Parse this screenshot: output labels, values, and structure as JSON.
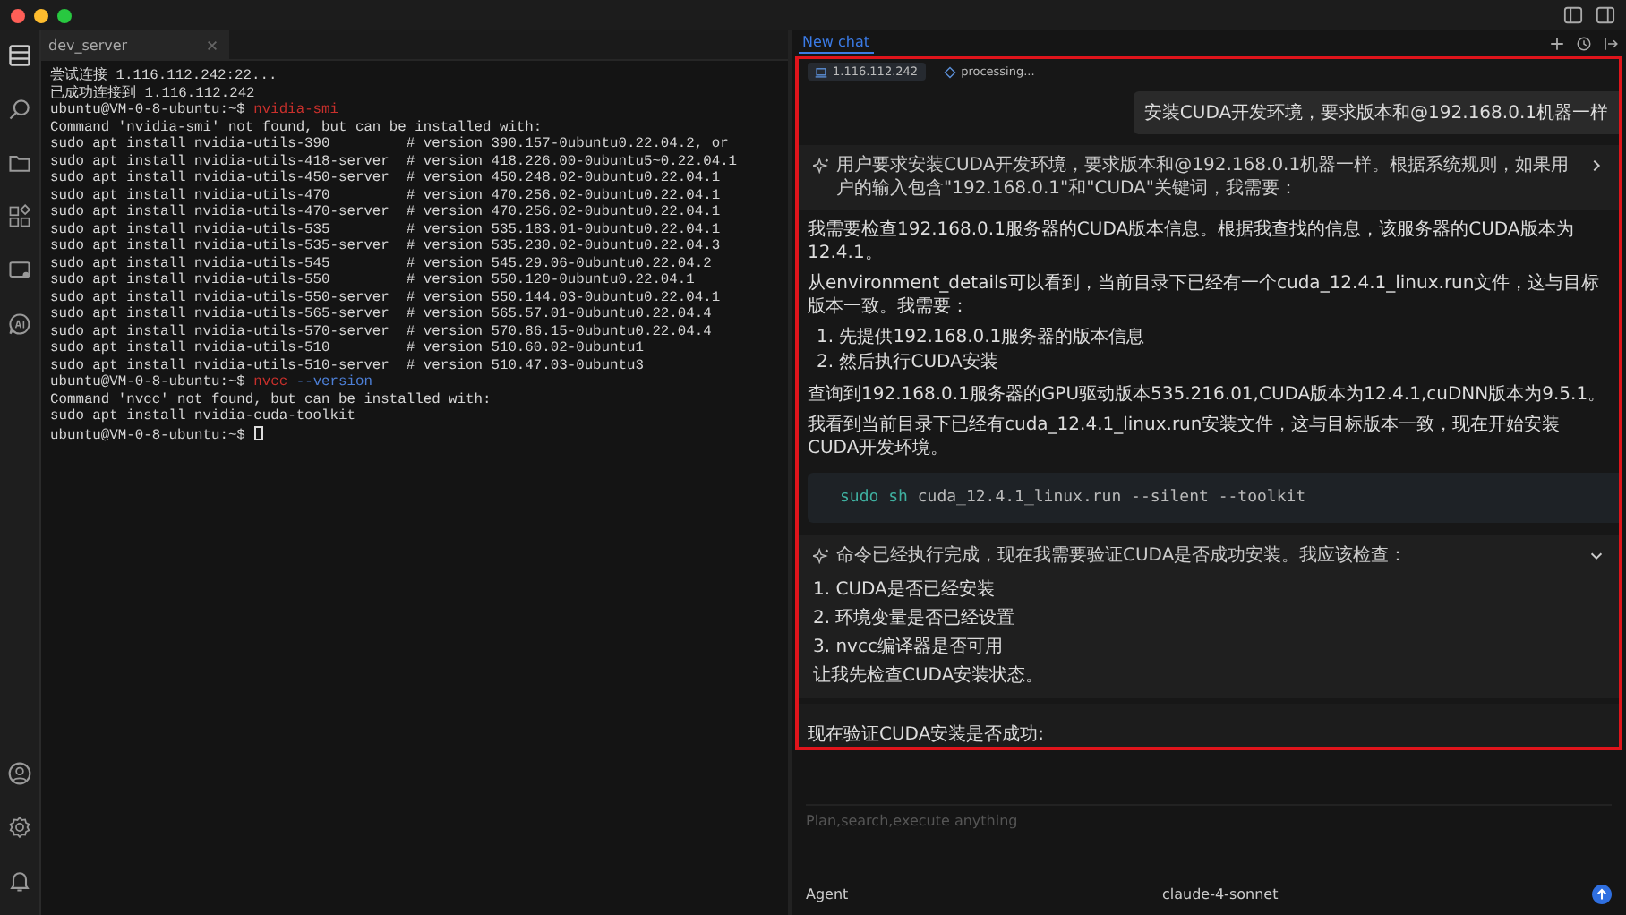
{
  "terminal": {
    "tab": {
      "label": "dev_server",
      "selected": true
    },
    "lines": [
      [
        {
          "text": "尝试连接 1.116.112.242:22...",
          "kind": "plain"
        }
      ],
      [
        {
          "text": "已成功连接到 1.116.112.242",
          "kind": "plain"
        }
      ],
      [
        {
          "text": "ubuntu@VM-0-8-ubuntu:~$ ",
          "kind": "plain"
        },
        {
          "text": "nvidia-smi",
          "kind": "command"
        }
      ],
      [
        {
          "text": "Command 'nvidia-smi' not found, but can be installed with:",
          "kind": "plain"
        }
      ],
      [
        {
          "text": "sudo apt install nvidia-utils-390         # version 390.157-0ubuntu0.22.04.2, or",
          "kind": "plain"
        }
      ],
      [
        {
          "text": "sudo apt install nvidia-utils-418-server  # version 418.226.00-0ubuntu5~0.22.04.1",
          "kind": "plain"
        }
      ],
      [
        {
          "text": "sudo apt install nvidia-utils-450-server  # version 450.248.02-0ubuntu0.22.04.1",
          "kind": "plain"
        }
      ],
      [
        {
          "text": "sudo apt install nvidia-utils-470         # version 470.256.02-0ubuntu0.22.04.1",
          "kind": "plain"
        }
      ],
      [
        {
          "text": "sudo apt install nvidia-utils-470-server  # version 470.256.02-0ubuntu0.22.04.1",
          "kind": "plain"
        }
      ],
      [
        {
          "text": "sudo apt install nvidia-utils-535         # version 535.183.01-0ubuntu0.22.04.1",
          "kind": "plain"
        }
      ],
      [
        {
          "text": "sudo apt install nvidia-utils-535-server  # version 535.230.02-0ubuntu0.22.04.3",
          "kind": "plain"
        }
      ],
      [
        {
          "text": "sudo apt install nvidia-utils-545         # version 545.29.06-0ubuntu0.22.04.2",
          "kind": "plain"
        }
      ],
      [
        {
          "text": "sudo apt install nvidia-utils-550         # version 550.120-0ubuntu0.22.04.1",
          "kind": "plain"
        }
      ],
      [
        {
          "text": "sudo apt install nvidia-utils-550-server  # version 550.144.03-0ubuntu0.22.04.1",
          "kind": "plain"
        }
      ],
      [
        {
          "text": "sudo apt install nvidia-utils-565-server  # version 565.57.01-0ubuntu0.22.04.4",
          "kind": "plain"
        }
      ],
      [
        {
          "text": "sudo apt install nvidia-utils-570-server  # version 570.86.15-0ubuntu0.22.04.4",
          "kind": "plain"
        }
      ],
      [
        {
          "text": "sudo apt install nvidia-utils-510         # version 510.60.02-0ubuntu1",
          "kind": "plain"
        }
      ],
      [
        {
          "text": "sudo apt install nvidia-utils-510-server  # version 510.47.03-0ubuntu3",
          "kind": "plain"
        }
      ],
      [
        {
          "text": "ubuntu@VM-0-8-ubuntu:~$ ",
          "kind": "plain"
        },
        {
          "text": "nvcc",
          "kind": "command"
        },
        {
          "text": " --version",
          "kind": "argument"
        }
      ],
      [
        {
          "text": "Command 'nvcc' not found, but can be installed with:",
          "kind": "plain"
        }
      ],
      [
        {
          "text": "sudo apt install nvidia-cuda-toolkit",
          "kind": "plain"
        }
      ],
      [
        {
          "text": "ubuntu@VM-0-8-ubuntu:~$ ",
          "kind": "plain"
        },
        {
          "kind": "cursor"
        }
      ]
    ]
  },
  "chat": {
    "tab": {
      "label": "New chat",
      "selected": true
    },
    "chips": [
      {
        "kind": "host",
        "label": "1.116.112.242"
      },
      {
        "kind": "status",
        "label": "processing..."
      }
    ],
    "user_message": "安装CUDA开发环境，要求版本和@192.168.0.1机器一样",
    "blocks": [
      {
        "kind": "thinking",
        "expanded": false,
        "text": "用户要求安装CUDA开发环境，要求版本和@192.168.0.1机器一样。根据系统规则，如果用户的输入包含\"192.168.0.1\"和\"CUDA\"关键词，我需要："
      },
      {
        "kind": "paragraph",
        "text": "我需要检查192.168.0.1服务器的CUDA版本信息。根据我查找的信息，该服务器的CUDA版本为12.4.1。"
      },
      {
        "kind": "paragraph",
        "text": "从environment_details可以看到，当前目录下已经有一个cuda_12.4.1_linux.run文件，这与目标版本一致。我需要："
      },
      {
        "kind": "list",
        "items": [
          "1. 先提供192.168.0.1服务器的版本信息",
          "2. 然后执行CUDA安装"
        ]
      },
      {
        "kind": "paragraph",
        "text": "查询到192.168.0.1服务器的GPU驱动版本535.216.01,CUDA版本为12.4.1,cuDNN版本为9.5.1。"
      },
      {
        "kind": "paragraph",
        "text": "我看到当前目录下已经有cuda_12.4.1_linux.run安装文件，这与目标版本一致，现在开始安装CUDA开发环境。"
      },
      {
        "kind": "code",
        "segments": [
          {
            "text": "sudo sh",
            "kind": "command"
          },
          {
            "text": " cuda_12.4.1_linux.run --silent --toolkit",
            "kind": "plain"
          }
        ]
      },
      {
        "kind": "thinking",
        "expanded": true,
        "text": "命令已经执行完成，现在我需要验证CUDA是否成功安装。我应该检查：",
        "items": [
          "1. CUDA是否已经安装",
          "2. 环境变量是否已经设置",
          "3. nvcc编译器是否可用"
        ],
        "after": "让我先检查CUDA安装状态。"
      },
      {
        "kind": "status",
        "text": "现在验证CUDA安装是否成功:"
      }
    ],
    "input": {
      "placeholder": "Plan,search,execute anything"
    },
    "mode": "Agent",
    "model": "claude-4-sonnet"
  }
}
